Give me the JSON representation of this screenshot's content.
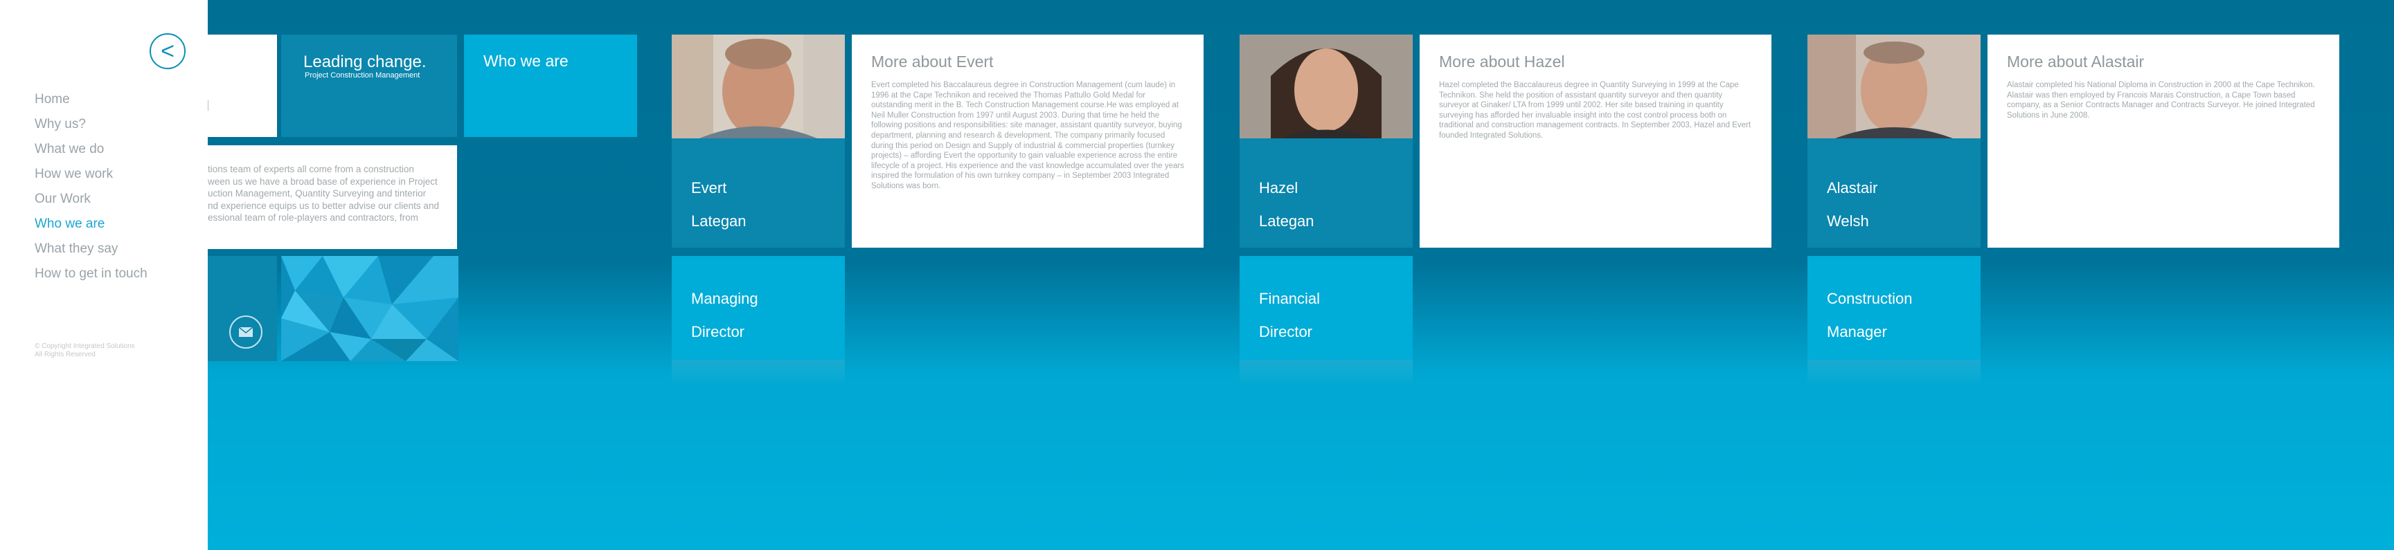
{
  "sidebar": {
    "back_glyph": "<",
    "nav": [
      {
        "label": "Home",
        "active": false
      },
      {
        "label": "Why us?",
        "active": false
      },
      {
        "label": "What we do",
        "active": false
      },
      {
        "label": "How we work",
        "active": false
      },
      {
        "label": "Our Work",
        "active": false
      },
      {
        "label": "Who we are",
        "active": true
      },
      {
        "label": "What they say",
        "active": false
      },
      {
        "label": "How to get in touch",
        "active": false
      }
    ],
    "copyright_line1": "© Copyright Integrated Solutions",
    "copyright_line2": "All Rights Reserved"
  },
  "intro": {
    "partial_word": "ed",
    "leading_title": "Leading change.",
    "leading_subtitle": "Project Construction Management",
    "who_title": "Who we are",
    "body": "tions team of experts all come from a construction\nween us we have a broad base of experience in Project\nuction Management, Quantity Surveying and tinterior\nnd experience equips us to better advise our clients and\nessional team of role-players and contractors, from",
    "mail_icon": "envelope-icon"
  },
  "people": [
    {
      "first": "Evert",
      "last": "Lategan",
      "role_line1": "Managing",
      "role_line2": "Director",
      "more_title": "More about Evert",
      "bio": "Evert completed his Baccalaureus degree in Construction Management (cum laude) in 1996 at the Cape Technikon and received the Thomas Pattullo Gold Medal for outstanding merit in the B. Tech Construction Management course.He was employed at Neil Muller Construction from 1997 until August 2003. During that time he held the following positions and responsibilities: site manager, assistant quantity surveyor, buying department, planning and research & development. The company primarily focused during this period on Design and Supply of industrial & commercial properties (turnkey projects) – affording Evert the opportunity to gain valuable experience across the entire lifecycle of a project. His experience and the vast knowledge accumulated over the years inspired the formulation of his own turnkey company – in September 2003 Integrated Solutions was born."
    },
    {
      "first": "Hazel",
      "last": "Lategan",
      "role_line1": "Financial",
      "role_line2": "Director",
      "more_title": "More about Hazel",
      "bio": "Hazel completed the Baccalaureus degree in Quantity Surveying in 1999 at the Cape Technikon. She held the position of assistant quantity surveyor and then quantity surveyor at Ginaker/ LTA from 1999 until 2002. Her site based training in quantity surveying has afforded her invaluable insight into the cost control process both on traditional and construction management contracts. In September 2003, Hazel and Evert founded Integrated Solutions."
    },
    {
      "first": "Alastair",
      "last": "Welsh",
      "role_line1": "Construction",
      "role_line2": "Manager",
      "more_title": "More about Alastair",
      "bio": "Alastair completed his National Diploma in Construction in 2000 at the Cape Technikon. Alastair was then employed by Francois Marais Construction, a Cape Town based company, as a Senior Contracts Manager and Contracts Surveyor. He joined Integrated Solutions in June 2008."
    }
  ],
  "colors": {
    "accent": "#1aa6d4",
    "tile_mid": "#0b86ad",
    "tile_light": "#00acd8"
  }
}
